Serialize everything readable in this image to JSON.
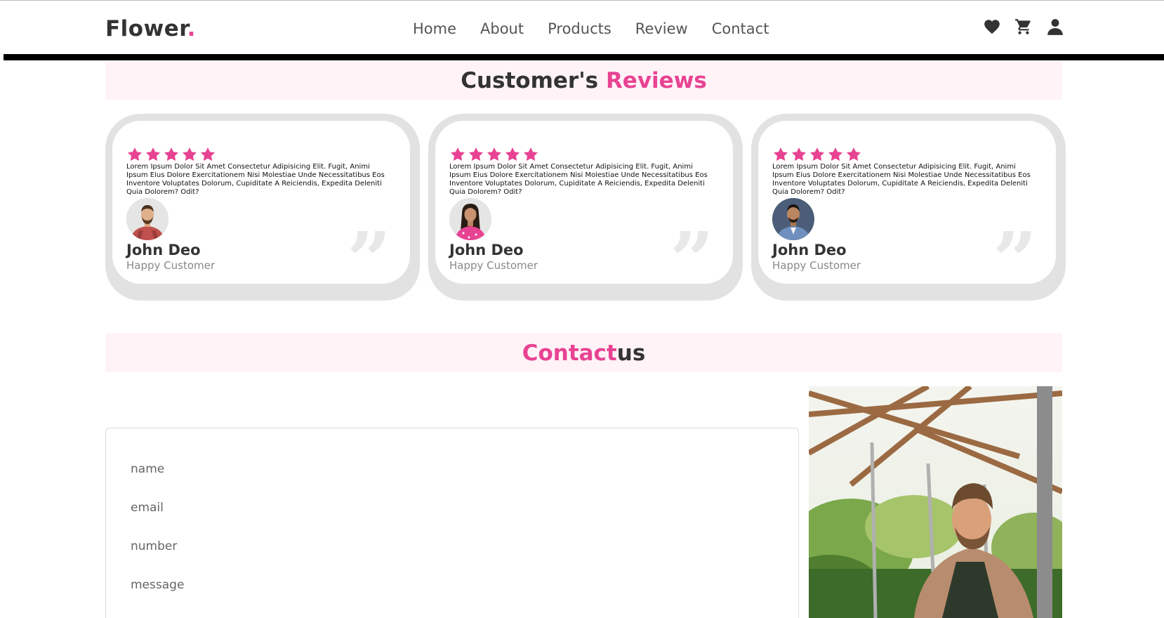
{
  "header": {
    "logo_text": "Flower",
    "logo_dot": ".",
    "nav": [
      "Home",
      "About",
      "Products",
      "Review",
      "Contact"
    ],
    "icons": [
      "heart-icon",
      "cart-icon",
      "user-icon"
    ]
  },
  "reviews_section": {
    "title_dark": "Customer's ",
    "title_pink": "Reviews",
    "cards": [
      {
        "rating": 5,
        "text": "Lorem Ipsum Dolor Sit Amet Consectetur Adipisicing Elit. Fugit, Animi Ipsum Eius Dolore Exercitationem Nisi Molestiae Unde Necessitatibus Eos Inventore Voluptates Dolorum, Cupiditate A Reiciendis, Expedita Deleniti Quia Dolorem? Odit?",
        "name": "John Deo",
        "role": "Happy Customer"
      },
      {
        "rating": 5,
        "text": "Lorem Ipsum Dolor Sit Amet Consectetur Adipisicing Elit. Fugit, Animi Ipsum Eius Dolore Exercitationem Nisi Molestiae Unde Necessitatibus Eos Inventore Voluptates Dolorum, Cupiditate A Reiciendis, Expedita Deleniti Quia Dolorem? Odit?",
        "name": "John Deo",
        "role": "Happy Customer"
      },
      {
        "rating": 5,
        "text": "Lorem Ipsum Dolor Sit Amet Consectetur Adipisicing Elit. Fugit, Animi Ipsum Eius Dolore Exercitationem Nisi Molestiae Unde Necessitatibus Eos Inventore Voluptates Dolorum, Cupiditate A Reiciendis, Expedita Deleniti Quia Dolorem? Odit?",
        "name": "John Deo",
        "role": "Happy Customer"
      }
    ],
    "quote_glyph": "”"
  },
  "contact_section": {
    "title_pink": "Contact",
    "title_dark": "us",
    "placeholders": {
      "name": "name",
      "email": "email",
      "number": "number",
      "message": "message"
    }
  },
  "colors": {
    "accent": "#e84393",
    "heading_bg": "#fff3f8",
    "text_dark": "#333333",
    "card_shadow": "#e2e2e2"
  }
}
